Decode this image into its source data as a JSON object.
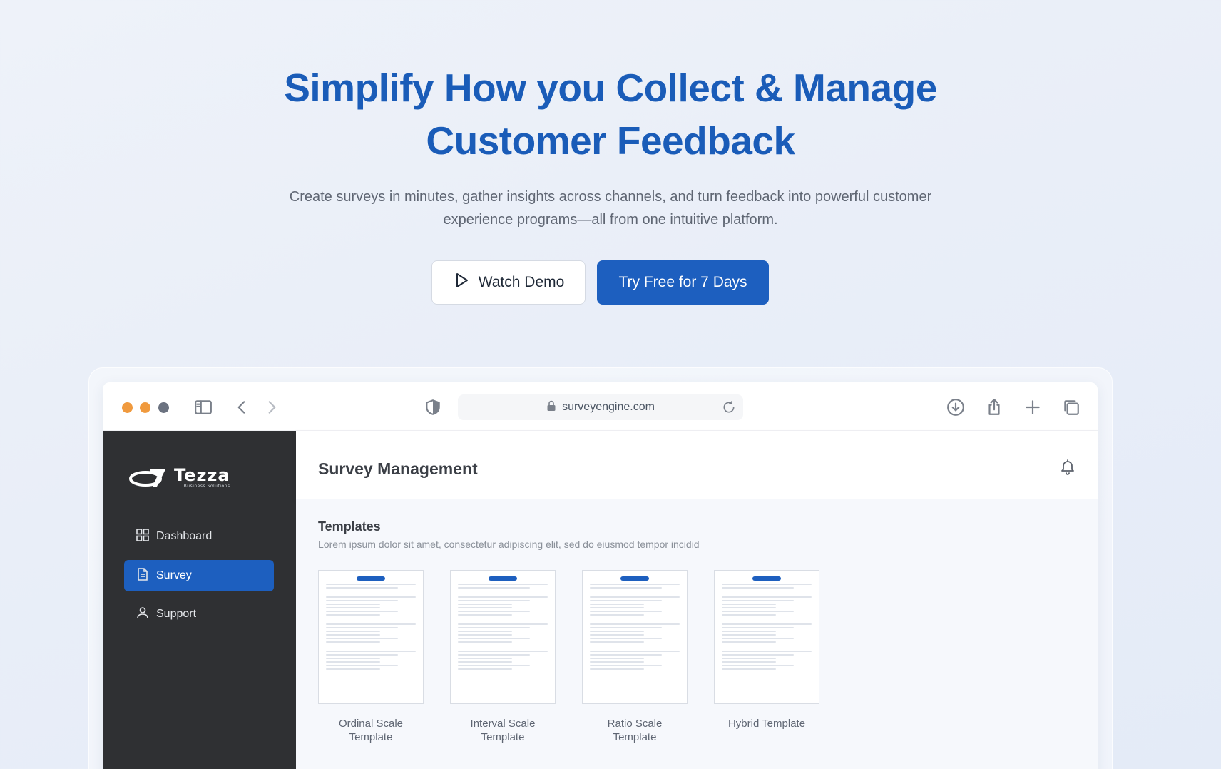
{
  "hero": {
    "title_line1": "Simplify How you Collect & Manage",
    "title_line2": "Customer Feedback",
    "subtitle": "Create surveys in minutes, gather insights across channels, and turn feedback into powerful customer experience programs—all from one intuitive platform.",
    "watch_demo_label": "Watch Demo",
    "try_free_label": "Try Free for 7 Days"
  },
  "browser": {
    "url": "surveyengine.com"
  },
  "app": {
    "brand": "Tezza",
    "brand_tagline": "Business Solutions",
    "header_title": "Survey Management",
    "nav": [
      {
        "label": "Dashboard",
        "icon": "grid-icon",
        "active": false
      },
      {
        "label": "Survey",
        "icon": "document-icon",
        "active": true
      },
      {
        "label": "Support",
        "icon": "user-icon",
        "active": false
      }
    ],
    "templates_title": "Templates",
    "templates_desc": "Lorem ipsum dolor sit amet, consectetur adipiscing elit, sed do eiusmod tempor incidid",
    "templates": [
      {
        "line1": "Ordinal Scale",
        "line2": "Template"
      },
      {
        "line1": "Interval Scale",
        "line2": "Template"
      },
      {
        "line1": "Ratio Scale",
        "line2": "Template"
      },
      {
        "line1": "Hybrid Template",
        "line2": ""
      }
    ]
  },
  "colors": {
    "primary": "#1d5fbf",
    "heading": "#1a5cb8",
    "sidebar": "#2f3033",
    "traffic_light": "#f09a3e"
  }
}
